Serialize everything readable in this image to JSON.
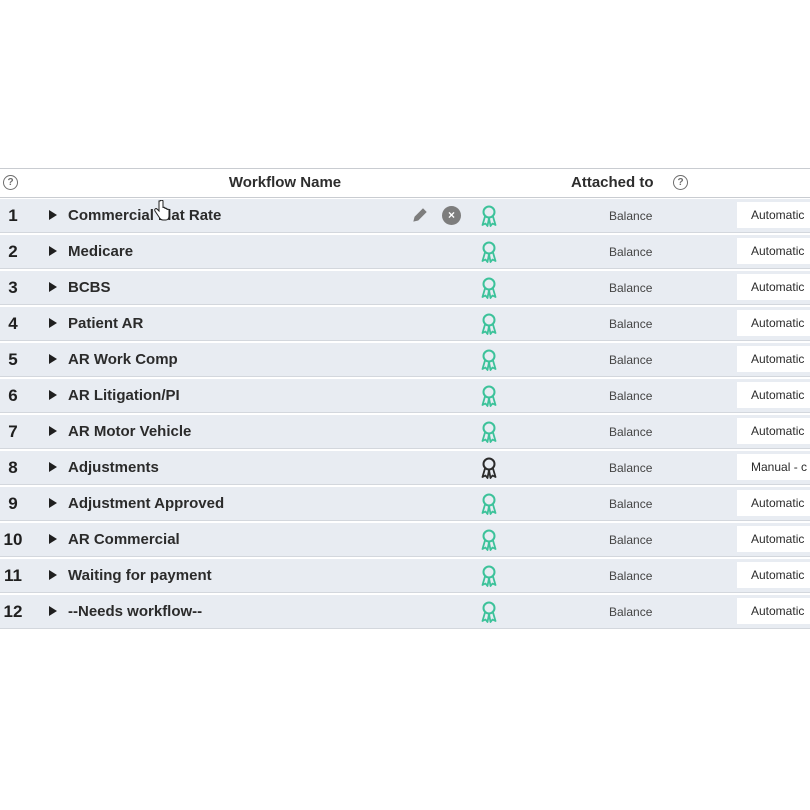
{
  "table": {
    "columns": {
      "name": "Workflow Name",
      "attached": "Attached to"
    },
    "help_glyph": "?",
    "remove_glyph": "×",
    "rows": [
      {
        "num": "1",
        "name": "Commercial Flat Rate",
        "attached": "Balance",
        "trigger": "Automatic",
        "badge_color": "#3cc29a",
        "show_actions": true
      },
      {
        "num": "2",
        "name": "Medicare",
        "attached": "Balance",
        "trigger": "Automatic",
        "badge_color": "#3cc29a"
      },
      {
        "num": "3",
        "name": "BCBS",
        "attached": "Balance",
        "trigger": "Automatic",
        "badge_color": "#3cc29a"
      },
      {
        "num": "4",
        "name": "Patient AR",
        "attached": "Balance",
        "trigger": "Automatic",
        "badge_color": "#3cc29a"
      },
      {
        "num": "5",
        "name": "AR Work Comp",
        "attached": "Balance",
        "trigger": "Automatic",
        "badge_color": "#3cc29a"
      },
      {
        "num": "6",
        "name": "AR Litigation/PI",
        "attached": "Balance",
        "trigger": "Automatic",
        "badge_color": "#3cc29a"
      },
      {
        "num": "7",
        "name": "AR Motor Vehicle",
        "attached": "Balance",
        "trigger": "Automatic",
        "badge_color": "#3cc29a"
      },
      {
        "num": "8",
        "name": "Adjustments",
        "attached": "Balance",
        "trigger": "Manual - c",
        "badge_color": "#2b2b2b"
      },
      {
        "num": "9",
        "name": "Adjustment Approved",
        "attached": "Balance",
        "trigger": "Automatic",
        "badge_color": "#3cc29a"
      },
      {
        "num": "10",
        "name": "AR Commercial",
        "attached": "Balance",
        "trigger": "Automatic",
        "badge_color": "#3cc29a"
      },
      {
        "num": "11",
        "name": "Waiting for payment",
        "attached": "Balance",
        "trigger": "Automatic",
        "badge_color": "#3cc29a"
      },
      {
        "num": "12",
        "name": "--Needs workflow--",
        "attached": "Balance",
        "trigger": "Automatic",
        "badge_color": "#3cc29a"
      }
    ]
  },
  "icons": {
    "expand": "caret-right-icon",
    "badge": "ribbon-badge-icon",
    "edit": "pencil-icon",
    "remove": "close-circle-icon",
    "help": "question-circle-icon",
    "cursor": "hand-pointer-icon"
  }
}
